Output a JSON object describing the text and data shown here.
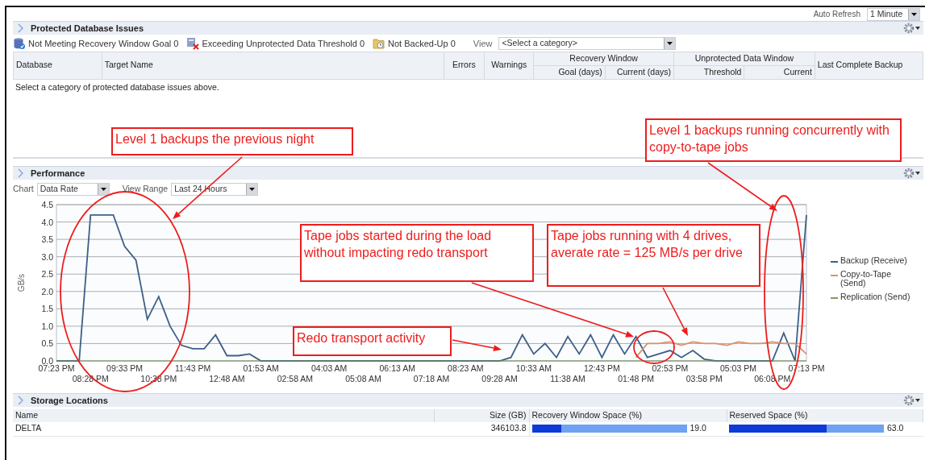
{
  "top_bar": {
    "auto_refresh_label": "Auto Refresh",
    "auto_refresh_value": "1 Minute"
  },
  "issues": {
    "title": "Protected Database Issues",
    "filters": [
      {
        "kind": "recovery",
        "label": "Not Meeting Recovery Window Goal 0"
      },
      {
        "kind": "unprotected",
        "label": "Exceeding Unprotected Data Threshold 0"
      },
      {
        "kind": "not-backed-up",
        "label": "Not Backed-Up 0"
      }
    ],
    "view_label": "View",
    "view_select": "<Select a category>",
    "columns": [
      {
        "label": "Database"
      },
      {
        "label": "Target Name"
      },
      {
        "label": "Errors"
      },
      {
        "label": "Warnings"
      },
      {
        "label": "Recovery Window",
        "children": [
          "Goal (days)",
          "Current (days)"
        ]
      },
      {
        "label": "Unprotected Data Window",
        "children": [
          "Threshold",
          "Current"
        ]
      },
      {
        "label": "Last Complete Backup"
      }
    ],
    "empty_message": "Select a category of protected database issues above."
  },
  "performance": {
    "title": "Performance",
    "chart_label": "Chart",
    "chart_select": "Data Rate",
    "range_label": "View Range",
    "range_select": "Last 24 Hours",
    "chart_data": {
      "type": "line",
      "grid": true,
      "legend": "right",
      "ylabel": "GB/s",
      "ylim": [
        0,
        4.5
      ],
      "yticks": [
        {
          "value": 0,
          "label": "0.0"
        },
        {
          "value": 0.5,
          "label": "0.5"
        },
        {
          "value": 1,
          "label": "1.0"
        },
        {
          "value": 1.5,
          "label": "1.5"
        },
        {
          "value": 2,
          "label": "2.0"
        },
        {
          "value": 2.5,
          "label": "2.5"
        },
        {
          "value": 3,
          "label": "3.0"
        },
        {
          "value": 3.5,
          "label": "3.5"
        },
        {
          "value": 4,
          "label": "4.0"
        },
        {
          "value": 4.5,
          "label": "4.5"
        }
      ],
      "categories": [
        "07:23 PM",
        null,
        null,
        "08:28 PM",
        null,
        null,
        "09:33 PM",
        null,
        null,
        "10:38 PM",
        null,
        null,
        "11:43 PM",
        null,
        null,
        "12:48 AM",
        null,
        null,
        "01:53 AM",
        null,
        null,
        "02:58 AM",
        null,
        null,
        "04:03 AM",
        null,
        null,
        "05:08 AM",
        null,
        null,
        "06:13 AM",
        null,
        null,
        "07:18 AM",
        null,
        null,
        "08:23 AM",
        null,
        null,
        "09:28 AM",
        null,
        null,
        "10:33 AM",
        null,
        null,
        "11:38 AM",
        null,
        null,
        "12:43 PM",
        null,
        null,
        "01:48 PM",
        null,
        null,
        "02:53 PM",
        null,
        null,
        "03:58 PM",
        null,
        null,
        "05:03 PM",
        null,
        null,
        "06:08 PM",
        null,
        null,
        "07:13 PM"
      ],
      "series": [
        {
          "name": "Backup (Receive)",
          "color": "#3d5f87",
          "values": [
            0,
            0,
            0,
            4.2,
            4.2,
            4.2,
            3.3,
            2.9,
            1.2,
            1.85,
            1.0,
            0.45,
            0.35,
            0.35,
            0.75,
            0.15,
            0.15,
            0.2,
            0,
            0,
            0,
            0,
            0,
            0,
            0,
            0,
            0,
            0,
            0,
            0,
            0,
            0,
            0,
            0,
            0,
            0,
            0,
            0,
            0,
            0,
            0.1,
            0.75,
            0.2,
            0.5,
            0.1,
            0.7,
            0.2,
            0.75,
            0.1,
            0.75,
            0.2,
            0.7,
            0.1,
            0.2,
            0.3,
            0.1,
            0.3,
            0.05,
            0,
            0,
            0,
            0,
            0,
            0,
            0.8,
            0,
            4.2
          ]
        },
        {
          "name": "Copy-to-Tape (Send)",
          "color": "#d9906a",
          "values": [
            null,
            null,
            null,
            null,
            null,
            null,
            null,
            null,
            null,
            null,
            null,
            null,
            null,
            null,
            null,
            null,
            null,
            null,
            null,
            null,
            null,
            null,
            null,
            null,
            null,
            null,
            null,
            null,
            null,
            null,
            null,
            null,
            null,
            null,
            null,
            null,
            null,
            null,
            null,
            null,
            null,
            null,
            null,
            null,
            null,
            null,
            null,
            null,
            null,
            null,
            null,
            0.1,
            0.5,
            0.5,
            0.55,
            0.45,
            0.55,
            0.5,
            0.5,
            0.45,
            0.55,
            0.5,
            0.5,
            0.55,
            0.5,
            0.5,
            0.2
          ]
        },
        {
          "name": "Replication (Send)",
          "color": "#7f9a5e",
          "values": [
            0,
            0,
            0,
            0,
            0,
            0,
            0,
            0,
            0,
            0,
            0,
            0,
            0,
            0,
            0,
            0,
            0,
            0,
            0,
            0,
            0,
            0,
            0,
            0,
            0,
            0,
            0,
            0,
            0,
            0,
            0,
            0,
            0,
            0,
            0,
            0,
            0,
            0,
            0,
            0,
            0,
            0,
            0,
            0,
            0,
            0,
            0,
            0,
            0,
            0,
            0,
            0,
            0,
            0,
            0,
            0,
            0,
            0,
            0,
            0,
            0,
            0,
            0,
            0,
            0,
            0,
            0
          ]
        }
      ]
    }
  },
  "storage": {
    "title": "Storage Locations",
    "columns": [
      "Name",
      "Size (GB)",
      "Recovery Window Space (%)",
      "Reserved Space (%)"
    ],
    "rows": [
      {
        "name": "DELTA",
        "size": "346103.8",
        "recovery": {
          "level": 0.19,
          "reading": "19.0"
        },
        "reserved": {
          "level": 0.63,
          "reading": "63.0"
        }
      }
    ]
  },
  "callouts": [
    {
      "text": "Level 1 backups the previous night"
    },
    {
      "text": "Level 1 backups running concurrently with copy-to-tape jobs"
    },
    {
      "text": "Tape jobs started during the load without impacting redo transport"
    },
    {
      "text": "Tape jobs running with 4 drives, averate rate = 125 MB/s per drive"
    },
    {
      "text": "Redo transport activity"
    }
  ]
}
